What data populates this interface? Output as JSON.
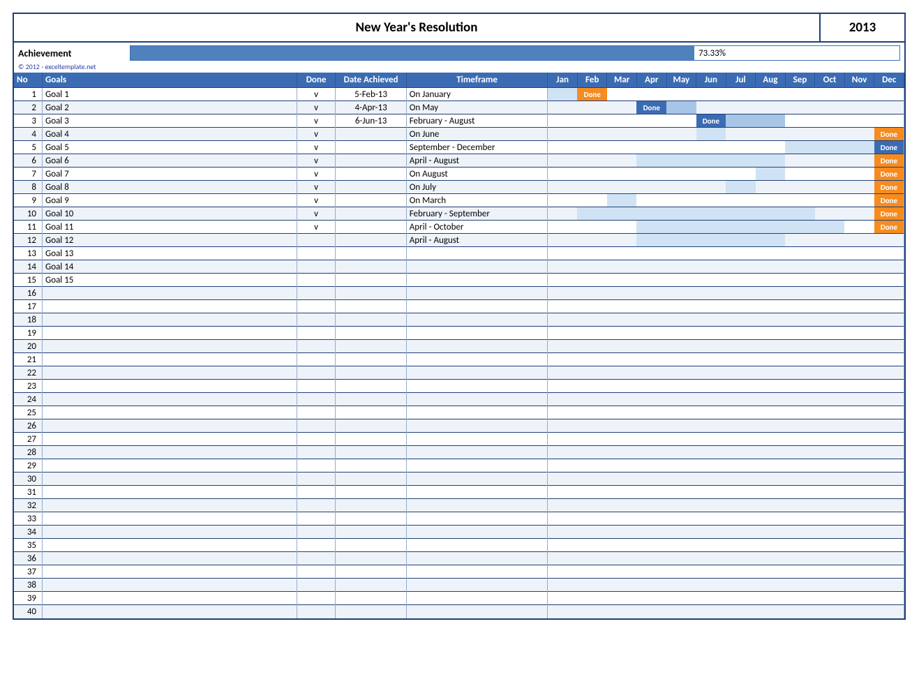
{
  "header": {
    "title": "New Year's Resolution",
    "year": "2013"
  },
  "achievement": {
    "label": "Achievement",
    "percent_text": "73.33%",
    "percent_value": 73.33
  },
  "copyright": "© 2012 - exceltemplate.net",
  "columns": {
    "no": "No",
    "goals": "Goals",
    "done": "Done",
    "date_achieved": "Date Achieved",
    "timeframe": "Timeframe",
    "months": [
      "Jan",
      "Feb",
      "Mar",
      "Apr",
      "May",
      "Jun",
      "Jul",
      "Aug",
      "Sep",
      "Oct",
      "Nov",
      "Dec"
    ]
  },
  "badge_label": "Done",
  "rows": [
    {
      "no": 1,
      "goal": "Goal 1",
      "done": "v",
      "date": "5-Feb-13",
      "timeframe": "On January",
      "months": [
        "light",
        "badge-orange",
        "",
        "",
        "",
        "",
        "",
        "",
        "",
        "",
        "",
        ""
      ]
    },
    {
      "no": 2,
      "goal": "Goal 2",
      "done": "v",
      "date": "4-Apr-13",
      "timeframe": "On May",
      "months": [
        "",
        "",
        "",
        "badge-blue",
        "mid",
        "",
        "",
        "",
        "",
        "",
        "",
        ""
      ]
    },
    {
      "no": 3,
      "goal": "Goal 3",
      "done": "v",
      "date": "6-Jun-13",
      "timeframe": "February - August",
      "months": [
        "",
        "",
        "",
        "",
        "",
        "badge-blue",
        "mid",
        "mid",
        "",
        "",
        "",
        ""
      ]
    },
    {
      "no": 4,
      "goal": "Goal 4",
      "done": "v",
      "date": "",
      "timeframe": "On June",
      "months": [
        "",
        "",
        "",
        "",
        "",
        "light",
        "",
        "",
        "",
        "",
        "",
        "badge-orange"
      ]
    },
    {
      "no": 5,
      "goal": "Goal 5",
      "done": "v",
      "date": "",
      "timeframe": "September - December",
      "months": [
        "",
        "",
        "",
        "",
        "",
        "",
        "",
        "",
        "light",
        "light",
        "light",
        "badge-blue"
      ]
    },
    {
      "no": 6,
      "goal": "Goal 6",
      "done": "v",
      "date": "",
      "timeframe": "April - August",
      "months": [
        "",
        "",
        "",
        "light",
        "light",
        "light",
        "light",
        "light",
        "",
        "",
        "",
        "badge-orange"
      ]
    },
    {
      "no": 7,
      "goal": "Goal 7",
      "done": "v",
      "date": "",
      "timeframe": "On August",
      "months": [
        "",
        "",
        "",
        "",
        "",
        "",
        "",
        "light",
        "",
        "",
        "",
        "badge-orange"
      ]
    },
    {
      "no": 8,
      "goal": "Goal 8",
      "done": "v",
      "date": "",
      "timeframe": "On July",
      "months": [
        "",
        "",
        "",
        "",
        "",
        "",
        "light",
        "",
        "",
        "",
        "",
        "badge-orange"
      ]
    },
    {
      "no": 9,
      "goal": "Goal 9",
      "done": "v",
      "date": "",
      "timeframe": "On March",
      "months": [
        "",
        "",
        "light",
        "",
        "",
        "",
        "",
        "",
        "",
        "",
        "",
        "badge-orange"
      ]
    },
    {
      "no": 10,
      "goal": "Goal 10",
      "done": "v",
      "date": "",
      "timeframe": "February - September",
      "months": [
        "",
        "light",
        "light",
        "light",
        "light",
        "light",
        "light",
        "light",
        "light",
        "",
        "",
        "badge-orange"
      ]
    },
    {
      "no": 11,
      "goal": "Goal 11",
      "done": "v",
      "date": "",
      "timeframe": "April - October",
      "months": [
        "",
        "",
        "",
        "light",
        "light",
        "light",
        "light",
        "light",
        "light",
        "light",
        "",
        "badge-orange"
      ]
    },
    {
      "no": 12,
      "goal": "Goal 12",
      "done": "",
      "date": "",
      "timeframe": "April - August",
      "months": [
        "",
        "",
        "",
        "light",
        "light",
        "light",
        "light",
        "light",
        "",
        "",
        "",
        ""
      ]
    },
    {
      "no": 13,
      "goal": "Goal 13",
      "done": "",
      "date": "",
      "timeframe": "",
      "months": [
        "",
        "",
        "",
        "",
        "",
        "",
        "",
        "",
        "",
        "",
        "",
        ""
      ]
    },
    {
      "no": 14,
      "goal": "Goal 14",
      "done": "",
      "date": "",
      "timeframe": "",
      "months": [
        "",
        "",
        "",
        "",
        "",
        "",
        "",
        "",
        "",
        "",
        "",
        ""
      ]
    },
    {
      "no": 15,
      "goal": "Goal 15",
      "done": "",
      "date": "",
      "timeframe": "",
      "months": [
        "",
        "",
        "",
        "",
        "",
        "",
        "",
        "",
        "",
        "",
        "",
        ""
      ]
    },
    {
      "no": 16,
      "goal": "",
      "done": "",
      "date": "",
      "timeframe": "",
      "months": [
        "",
        "",
        "",
        "",
        "",
        "",
        "",
        "",
        "",
        "",
        "",
        ""
      ]
    },
    {
      "no": 17,
      "goal": "",
      "done": "",
      "date": "",
      "timeframe": "",
      "months": [
        "",
        "",
        "",
        "",
        "",
        "",
        "",
        "",
        "",
        "",
        "",
        ""
      ]
    },
    {
      "no": 18,
      "goal": "",
      "done": "",
      "date": "",
      "timeframe": "",
      "months": [
        "",
        "",
        "",
        "",
        "",
        "",
        "",
        "",
        "",
        "",
        "",
        ""
      ]
    },
    {
      "no": 19,
      "goal": "",
      "done": "",
      "date": "",
      "timeframe": "",
      "months": [
        "",
        "",
        "",
        "",
        "",
        "",
        "",
        "",
        "",
        "",
        "",
        ""
      ]
    },
    {
      "no": 20,
      "goal": "",
      "done": "",
      "date": "",
      "timeframe": "",
      "months": [
        "",
        "",
        "",
        "",
        "",
        "",
        "",
        "",
        "",
        "",
        "",
        ""
      ]
    },
    {
      "no": 21,
      "goal": "",
      "done": "",
      "date": "",
      "timeframe": "",
      "months": [
        "",
        "",
        "",
        "",
        "",
        "",
        "",
        "",
        "",
        "",
        "",
        ""
      ]
    },
    {
      "no": 22,
      "goal": "",
      "done": "",
      "date": "",
      "timeframe": "",
      "months": [
        "",
        "",
        "",
        "",
        "",
        "",
        "",
        "",
        "",
        "",
        "",
        ""
      ]
    },
    {
      "no": 23,
      "goal": "",
      "done": "",
      "date": "",
      "timeframe": "",
      "months": [
        "",
        "",
        "",
        "",
        "",
        "",
        "",
        "",
        "",
        "",
        "",
        ""
      ]
    },
    {
      "no": 24,
      "goal": "",
      "done": "",
      "date": "",
      "timeframe": "",
      "months": [
        "",
        "",
        "",
        "",
        "",
        "",
        "",
        "",
        "",
        "",
        "",
        ""
      ]
    },
    {
      "no": 25,
      "goal": "",
      "done": "",
      "date": "",
      "timeframe": "",
      "months": [
        "",
        "",
        "",
        "",
        "",
        "",
        "",
        "",
        "",
        "",
        "",
        ""
      ]
    },
    {
      "no": 26,
      "goal": "",
      "done": "",
      "date": "",
      "timeframe": "",
      "months": [
        "",
        "",
        "",
        "",
        "",
        "",
        "",
        "",
        "",
        "",
        "",
        ""
      ]
    },
    {
      "no": 27,
      "goal": "",
      "done": "",
      "date": "",
      "timeframe": "",
      "months": [
        "",
        "",
        "",
        "",
        "",
        "",
        "",
        "",
        "",
        "",
        "",
        ""
      ]
    },
    {
      "no": 28,
      "goal": "",
      "done": "",
      "date": "",
      "timeframe": "",
      "months": [
        "",
        "",
        "",
        "",
        "",
        "",
        "",
        "",
        "",
        "",
        "",
        ""
      ]
    },
    {
      "no": 29,
      "goal": "",
      "done": "",
      "date": "",
      "timeframe": "",
      "months": [
        "",
        "",
        "",
        "",
        "",
        "",
        "",
        "",
        "",
        "",
        "",
        ""
      ]
    },
    {
      "no": 30,
      "goal": "",
      "done": "",
      "date": "",
      "timeframe": "",
      "months": [
        "",
        "",
        "",
        "",
        "",
        "",
        "",
        "",
        "",
        "",
        "",
        ""
      ]
    },
    {
      "no": 31,
      "goal": "",
      "done": "",
      "date": "",
      "timeframe": "",
      "months": [
        "",
        "",
        "",
        "",
        "",
        "",
        "",
        "",
        "",
        "",
        "",
        ""
      ]
    },
    {
      "no": 32,
      "goal": "",
      "done": "",
      "date": "",
      "timeframe": "",
      "months": [
        "",
        "",
        "",
        "",
        "",
        "",
        "",
        "",
        "",
        "",
        "",
        ""
      ]
    },
    {
      "no": 33,
      "goal": "",
      "done": "",
      "date": "",
      "timeframe": "",
      "months": [
        "",
        "",
        "",
        "",
        "",
        "",
        "",
        "",
        "",
        "",
        "",
        ""
      ]
    },
    {
      "no": 34,
      "goal": "",
      "done": "",
      "date": "",
      "timeframe": "",
      "months": [
        "",
        "",
        "",
        "",
        "",
        "",
        "",
        "",
        "",
        "",
        "",
        ""
      ]
    },
    {
      "no": 35,
      "goal": "",
      "done": "",
      "date": "",
      "timeframe": "",
      "months": [
        "",
        "",
        "",
        "",
        "",
        "",
        "",
        "",
        "",
        "",
        "",
        ""
      ]
    },
    {
      "no": 36,
      "goal": "",
      "done": "",
      "date": "",
      "timeframe": "",
      "months": [
        "",
        "",
        "",
        "",
        "",
        "",
        "",
        "",
        "",
        "",
        "",
        ""
      ]
    },
    {
      "no": 37,
      "goal": "",
      "done": "",
      "date": "",
      "timeframe": "",
      "months": [
        "",
        "",
        "",
        "",
        "",
        "",
        "",
        "",
        "",
        "",
        "",
        ""
      ]
    },
    {
      "no": 38,
      "goal": "",
      "done": "",
      "date": "",
      "timeframe": "",
      "months": [
        "",
        "",
        "",
        "",
        "",
        "",
        "",
        "",
        "",
        "",
        "",
        ""
      ]
    },
    {
      "no": 39,
      "goal": "",
      "done": "",
      "date": "",
      "timeframe": "",
      "months": [
        "",
        "",
        "",
        "",
        "",
        "",
        "",
        "",
        "",
        "",
        "",
        ""
      ]
    },
    {
      "no": 40,
      "goal": "",
      "done": "",
      "date": "",
      "timeframe": "",
      "months": [
        "",
        "",
        "",
        "",
        "",
        "",
        "",
        "",
        "",
        "",
        "",
        ""
      ]
    }
  ]
}
